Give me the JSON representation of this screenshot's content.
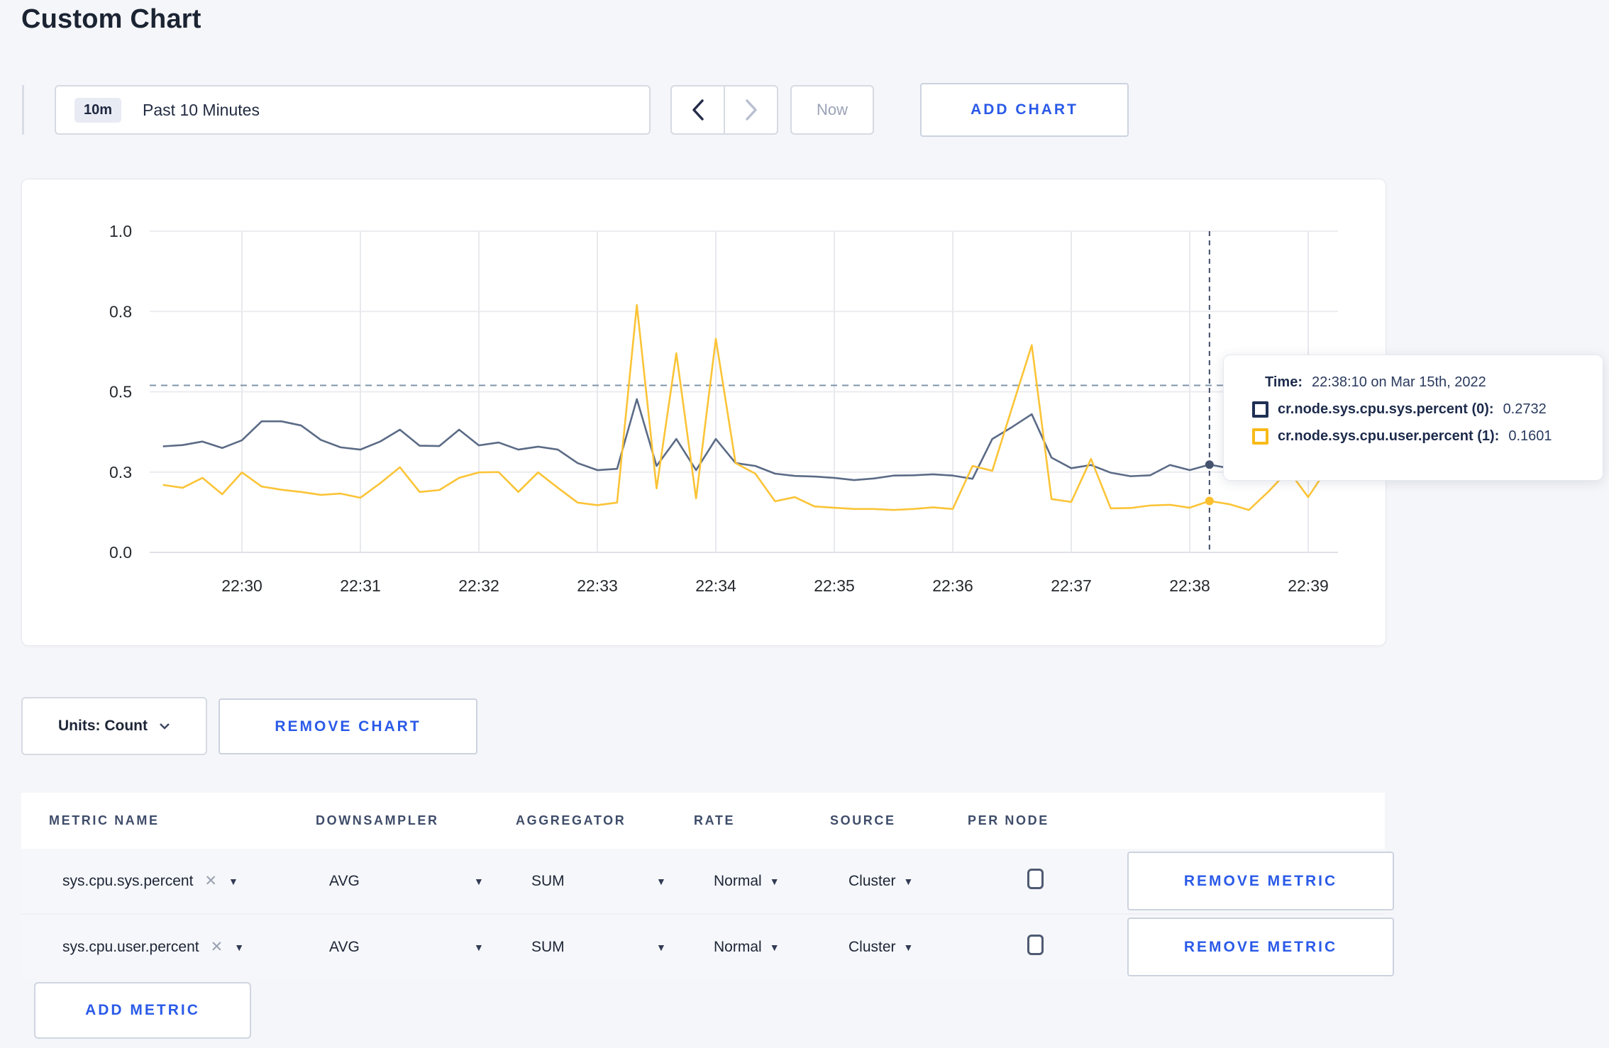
{
  "page": {
    "title": "Custom Chart",
    "background": "#f5f6f9",
    "accent_blue": "#2a5ae8"
  },
  "toolbar": {
    "time_badge": "10m",
    "time_label": "Past 10 Minutes",
    "prev_icon": "chevron-left",
    "next_icon": "chevron-right",
    "now_label": "Now",
    "add_chart_label": "ADD CHART"
  },
  "chart_data": {
    "type": "line",
    "title": "",
    "xlabel": "",
    "ylabel": "",
    "ylim": [
      0,
      1
    ],
    "grid": true,
    "legend_position": "tooltip-only",
    "y_tick_values": [
      0,
      0.25,
      0.5,
      0.75,
      1.0
    ],
    "y_tick_labels": [
      "0.0",
      "0.3",
      "0.5",
      "0.8",
      "1.0"
    ],
    "x_tick_labels": [
      "22:30",
      "22:31",
      "22:32",
      "22:33",
      "22:34",
      "22:35",
      "22:36",
      "22:37",
      "22:38",
      "22:39"
    ],
    "dashed_reference_value": 0.52,
    "crosshair_time": "22:38:10",
    "times": [
      "22:29:20",
      "22:29:30",
      "22:29:40",
      "22:29:50",
      "22:30:00",
      "22:30:10",
      "22:30:20",
      "22:30:30",
      "22:30:40",
      "22:30:50",
      "22:31:00",
      "22:31:10",
      "22:31:20",
      "22:31:30",
      "22:31:40",
      "22:31:50",
      "22:32:00",
      "22:32:10",
      "22:32:20",
      "22:32:30",
      "22:32:40",
      "22:32:50",
      "22:33:00",
      "22:33:10",
      "22:33:20",
      "22:33:30",
      "22:33:40",
      "22:33:50",
      "22:34:00",
      "22:34:10",
      "22:34:20",
      "22:34:30",
      "22:34:40",
      "22:34:50",
      "22:35:00",
      "22:35:10",
      "22:35:20",
      "22:35:30",
      "22:35:40",
      "22:35:50",
      "22:36:00",
      "22:36:10",
      "22:36:20",
      "22:36:30",
      "22:36:40",
      "22:36:50",
      "22:37:00",
      "22:37:10",
      "22:37:20",
      "22:37:30",
      "22:37:40",
      "22:37:50",
      "22:38:00",
      "22:38:10",
      "22:38:20",
      "22:38:30",
      "22:38:40",
      "22:38:50",
      "22:39:00",
      "22:39:10"
    ],
    "series": [
      {
        "name": "cr.node.sys.cpu.sys.percent",
        "color": "#5b6b86",
        "dot_color": "#46536e",
        "values": [
          0.33,
          0.334,
          0.345,
          0.325,
          0.349,
          0.408,
          0.408,
          0.395,
          0.35,
          0.327,
          0.32,
          0.345,
          0.382,
          0.332,
          0.331,
          0.382,
          0.333,
          0.342,
          0.32,
          0.329,
          0.32,
          0.278,
          0.256,
          0.26,
          0.477,
          0.269,
          0.353,
          0.256,
          0.353,
          0.278,
          0.269,
          0.245,
          0.238,
          0.236,
          0.232,
          0.225,
          0.23,
          0.239,
          0.24,
          0.243,
          0.239,
          0.229,
          0.353,
          0.39,
          0.43,
          0.295,
          0.262,
          0.272,
          0.248,
          0.237,
          0.24,
          0.272,
          0.256,
          0.2732,
          0.262,
          0.252,
          0.258,
          0.252,
          0.256,
          0.26
        ]
      },
      {
        "name": "cr.node.sys.cpu.user.percent",
        "color": "#fbc437",
        "dot_color": "#fbbf2d",
        "values": [
          0.21,
          0.201,
          0.232,
          0.181,
          0.249,
          0.205,
          0.195,
          0.188,
          0.179,
          0.183,
          0.17,
          0.215,
          0.265,
          0.188,
          0.194,
          0.232,
          0.249,
          0.25,
          0.188,
          0.249,
          0.201,
          0.155,
          0.147,
          0.155,
          0.77,
          0.199,
          0.62,
          0.168,
          0.665,
          0.278,
          0.245,
          0.159,
          0.172,
          0.143,
          0.139,
          0.135,
          0.135,
          0.132,
          0.135,
          0.14,
          0.135,
          0.269,
          0.254,
          0.45,
          0.645,
          0.166,
          0.157,
          0.291,
          0.137,
          0.138,
          0.146,
          0.148,
          0.139,
          0.1601,
          0.15,
          0.132,
          0.19,
          0.255,
          0.172,
          0.265
        ]
      }
    ]
  },
  "tooltip": {
    "time_label": "Time:",
    "time_value": "22:38:10 on Mar 15th, 2022",
    "entries": [
      {
        "name": "cr.node.sys.cpu.sys.percent (0):",
        "value": "0.2732"
      },
      {
        "name": "cr.node.sys.cpu.user.percent (1):",
        "value": "0.1601"
      }
    ]
  },
  "units": {
    "label": "Units: Count",
    "remove_chart_label": "REMOVE CHART"
  },
  "metrics_table": {
    "headers": [
      "METRIC NAME",
      "DOWNSAMPLER",
      "AGGREGATOR",
      "RATE",
      "SOURCE",
      "PER NODE"
    ],
    "rows": [
      {
        "metric": "sys.cpu.sys.percent",
        "downsampler": "AVG",
        "aggregator": "SUM",
        "rate": "Normal",
        "source": "Cluster",
        "per_node_checked": false,
        "remove_label": "REMOVE METRIC"
      },
      {
        "metric": "sys.cpu.user.percent",
        "downsampler": "AVG",
        "aggregator": "SUM",
        "rate": "Normal",
        "source": "Cluster",
        "per_node_checked": false,
        "remove_label": "REMOVE METRIC"
      }
    ],
    "add_metric_label": "ADD METRIC"
  }
}
